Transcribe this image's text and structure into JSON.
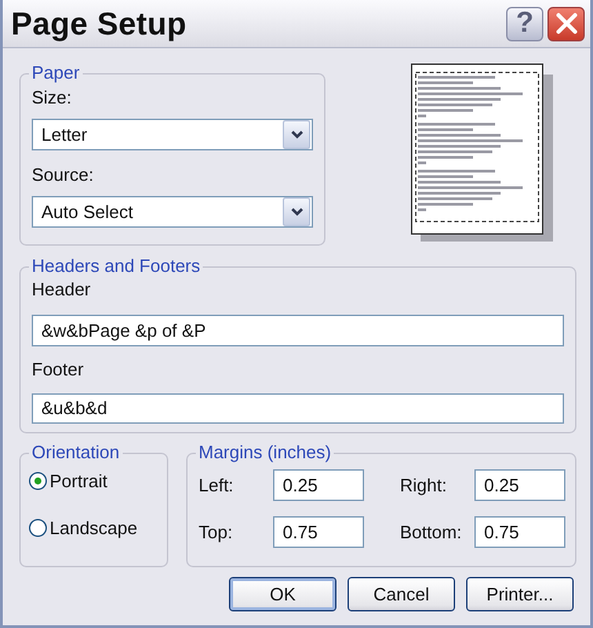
{
  "window": {
    "title": "Page Setup",
    "help_button": "?"
  },
  "paper": {
    "legend": "Paper",
    "size_label": "Size:",
    "size": "Letter",
    "source_label": "Source:",
    "source": "Auto Select"
  },
  "headers_footers": {
    "legend": "Headers and Footers",
    "header_label": "Header",
    "header": "&w&bPage &p of &P",
    "footer_label": "Footer",
    "footer": "&u&b&d"
  },
  "orientation": {
    "legend": "Orientation",
    "options": [
      {
        "label": "Portrait",
        "selected": true
      },
      {
        "label": "Landscape",
        "selected": false
      }
    ]
  },
  "margins": {
    "legend": "Margins (inches)",
    "fields": [
      {
        "label": "Left:",
        "value": "0.25"
      },
      {
        "label": "Right:",
        "value": "0.25"
      },
      {
        "label": "Top:",
        "value": "0.75"
      },
      {
        "label": "Bottom:",
        "value": "0.75"
      }
    ]
  },
  "buttons": [
    {
      "label": "OK",
      "default": true
    },
    {
      "label": "Cancel",
      "default": false
    },
    {
      "label": "Printer...",
      "default": false
    }
  ]
}
